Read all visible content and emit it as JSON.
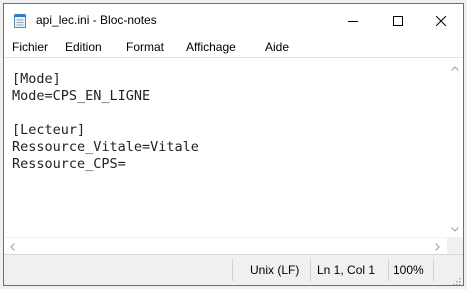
{
  "window": {
    "title": "api_lec.ini - Bloc-notes"
  },
  "menu": [
    "Fichier",
    "Edition",
    "Format",
    "Affichage",
    "Aide"
  ],
  "editor": {
    "lines": [
      "[Mode]",
      "Mode=CPS_EN_LIGNE",
      "",
      "[Lecteur]",
      "Ressource_Vitale=Vitale",
      "Ressource_CPS="
    ]
  },
  "status": {
    "eol": "Unix (LF)",
    "position": "Ln 1, Col 1",
    "zoom": "100%"
  },
  "icons": {
    "app": "notepad-icon",
    "minimize": "minimize-icon",
    "maximize": "maximize-icon",
    "close": "close-icon",
    "scroll_up": "chevron-up-icon",
    "scroll_down": "chevron-down-icon",
    "scroll_left": "chevron-left-icon",
    "scroll_right": "chevron-right-icon",
    "grip": "resize-grip-icon"
  }
}
